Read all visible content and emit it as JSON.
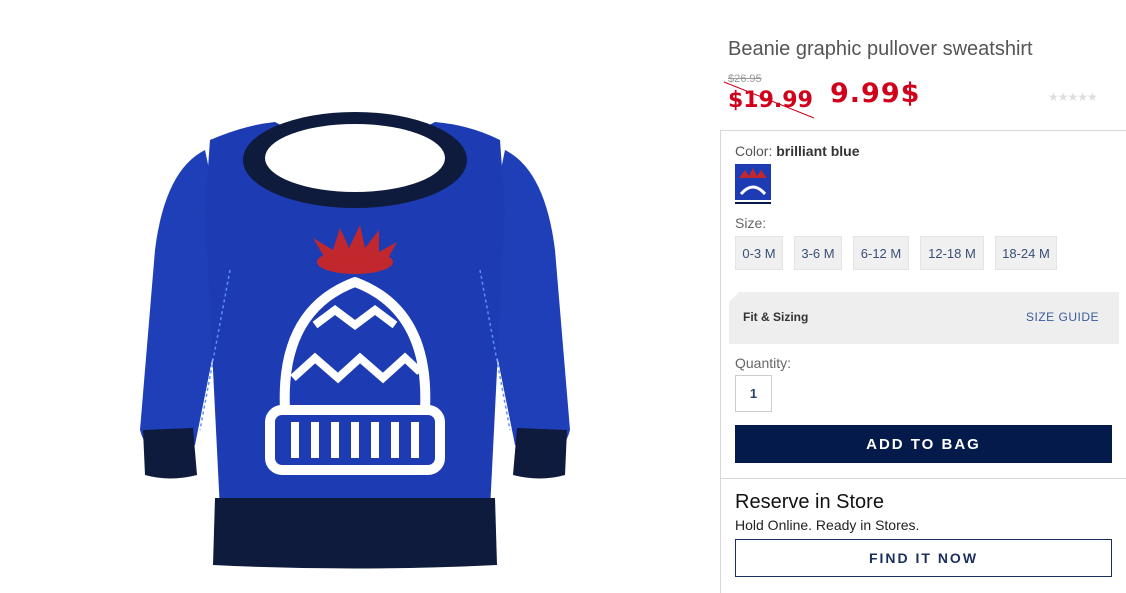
{
  "product": {
    "title": "Beanie graphic pullover sweatshirt",
    "old_price": "$26.95",
    "sale_price": "$19.99",
    "new_price": "9.99$",
    "rating_stars": "★★★★★"
  },
  "color": {
    "label": "Color:",
    "value": "brilliant blue"
  },
  "size": {
    "label": "Size:",
    "options": [
      "0-3 M",
      "3-6 M",
      "6-12 M",
      "12-18 M",
      "18-24 M"
    ]
  },
  "fit": {
    "label": "Fit & Sizing",
    "guide_link": "SIZE GUIDE"
  },
  "quantity": {
    "label": "Quantity:",
    "value": "1"
  },
  "actions": {
    "add_to_bag": "ADD TO BAG"
  },
  "reserve": {
    "title": "Reserve in Store",
    "subtitle": "Hold Online. Ready in Stores.",
    "find_button": "FIND IT NOW"
  },
  "colors": {
    "price_red": "#d0021b",
    "navy": "#031a4a",
    "sweater_blue": "#1f3fb8"
  }
}
